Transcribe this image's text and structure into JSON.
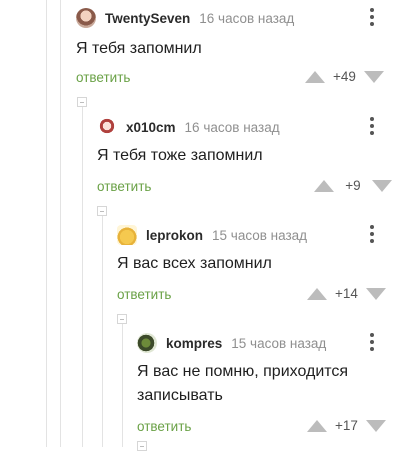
{
  "comments": [
    {
      "author": "TwentySeven",
      "time": "16 часов назад",
      "text": "Я тебя запомнил",
      "reply_label": "ответить",
      "score": "+49",
      "avatar": "photo-avatar"
    },
    {
      "author": "x010cm",
      "time": "16 часов назад",
      "text": "Я тебя тоже запомнил",
      "reply_label": "ответить",
      "score": "+9",
      "avatar": "anime-avatar"
    },
    {
      "author": "leprokon",
      "time": "15 часов назад",
      "text": "Я вас всех запомнил",
      "reply_label": "ответить",
      "score": "+14",
      "avatar": "cat-avatar"
    },
    {
      "author": "kompres",
      "time": "15 часов назад",
      "text_line1": "Я вас не помню, приходится",
      "text_line2": "записывать",
      "reply_label": "ответить",
      "score": "+17",
      "avatar": "leaf-avatar"
    }
  ],
  "colors": {
    "reply": "#6aa146",
    "vote_arrow": "#bcbcbc",
    "guide": "#e3e3e3"
  }
}
